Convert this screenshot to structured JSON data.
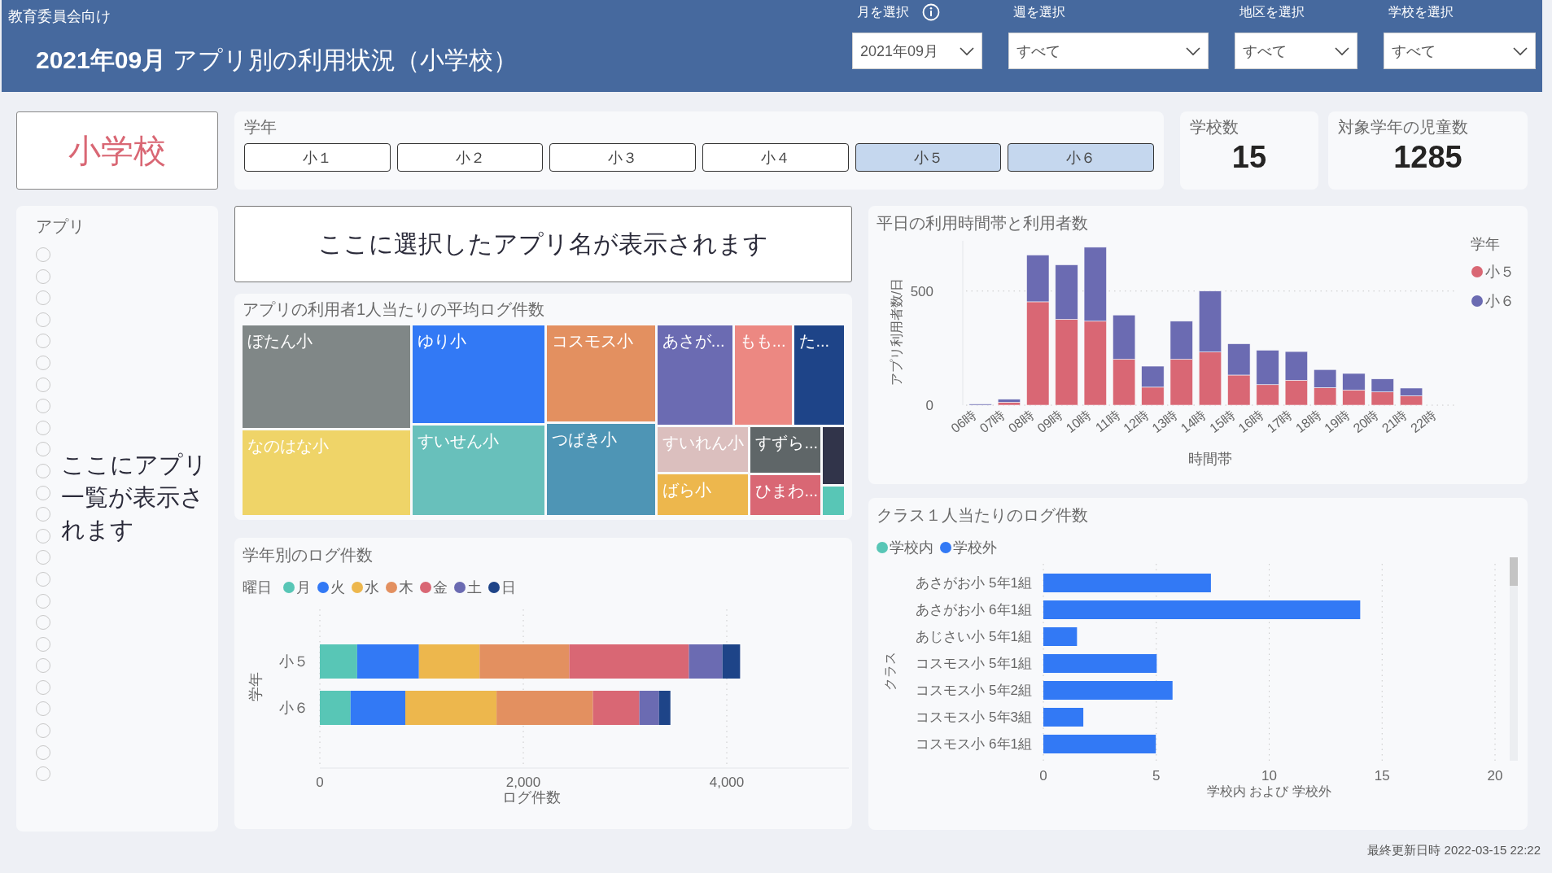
{
  "header": {
    "subtitle": "教育委員会向け",
    "title": "**2021年09月** アプリ別の利用状況（小学校）",
    "filters": [
      {
        "label": "月を選択",
        "value": "2021年09月",
        "info": true
      },
      {
        "label": "週を選択",
        "value": "すべて",
        "info": false
      },
      {
        "label": "地区を選択",
        "value": "すべて",
        "info": false
      },
      {
        "label": "学校を選択",
        "value": "すべて",
        "info": false
      }
    ]
  },
  "school_type": "小学校",
  "grade_slicer": {
    "title": "学年",
    "items": [
      {
        "label": "小１",
        "selected": false
      },
      {
        "label": "小２",
        "selected": false
      },
      {
        "label": "小３",
        "selected": false
      },
      {
        "label": "小４",
        "selected": false
      },
      {
        "label": "小５",
        "selected": true
      },
      {
        "label": "小６",
        "selected": true
      }
    ]
  },
  "kpis": [
    {
      "label": "学校数",
      "value": "15"
    },
    {
      "label": "対象学年の児童数",
      "value": "1285"
    }
  ],
  "app_list": {
    "title": "アプリ",
    "overlay_text": "ここにアプリ一覧が表示されます",
    "options": [
      {
        "selected": false
      },
      {
        "selected": false
      },
      {
        "selected": false
      },
      {
        "selected": false
      },
      {
        "selected": false
      },
      {
        "selected": false
      },
      {
        "selected": false
      },
      {
        "selected": false
      },
      {
        "selected": false
      },
      {
        "selected": false
      },
      {
        "selected": false
      },
      {
        "selected": false
      },
      {
        "selected": false
      },
      {
        "selected": false
      },
      {
        "selected": false
      },
      {
        "selected": false
      },
      {
        "selected": false
      },
      {
        "selected": false
      },
      {
        "selected": false
      },
      {
        "selected": false
      },
      {
        "selected": false
      },
      {
        "selected": false
      },
      {
        "selected": false
      },
      {
        "selected": false
      },
      {
        "selected": false
      }
    ]
  },
  "app_name_box": {
    "text": "ここに選択したアプリ名が表示されます"
  },
  "treemap": {
    "title": "アプリの利用者1人当たりの平均ログ件数",
    "blocks": [
      {
        "tiles": [
          {
            "label": "ぼたん小",
            "color": "#808787"
          },
          {
            "label": "なのはな小",
            "color": "#efd468"
          }
        ]
      },
      {
        "tiles": [
          {
            "label": "ゆり小",
            "color": "#3279f5"
          },
          {
            "label": "すいせん小",
            "color": "#68c0bb"
          }
        ]
      },
      {
        "tiles": [
          {
            "label": "コスモス小",
            "color": "#e39060"
          },
          {
            "label": "つばき小",
            "color": "#4e95b5"
          }
        ]
      },
      {
        "top": [
          {
            "label": "あさが...",
            "color": "#6b6bb2"
          },
          {
            "label": "もも...",
            "color": "#ec8882"
          },
          {
            "label": "た...",
            "color": "#1e4488"
          }
        ],
        "bottom": [
          {
            "tiles": [
              {
                "label": "すいれん小",
                "color": "#dbbfbe"
              },
              {
                "label": "ばら小",
                "color": "#edb74d"
              }
            ]
          },
          {
            "tiles": [
              {
                "label": "すずら...",
                "color": "#5f6668"
              },
              {
                "label": "ひまわ...",
                "color": "#d96774"
              }
            ]
          },
          {
            "tiles": [
              {
                "color": "#31344a"
              },
              {
                "color": "#58c6b6"
              }
            ]
          }
        ]
      }
    ]
  },
  "weekday_chart": {
    "chart_data": {
      "type": "bar",
      "orientation": "horizontal",
      "stacked": true,
      "title": "学年別のログ件数",
      "legend_title": "曜日",
      "xlabel": "ログ件数",
      "ylabel": "学年",
      "categories": [
        "小５",
        "小６"
      ],
      "series": [
        {
          "name": "月",
          "color": "#58c6b6",
          "values": [
            367,
            302
          ]
        },
        {
          "name": "火",
          "color": "#3279f5",
          "values": [
            607,
            538
          ]
        },
        {
          "name": "水",
          "color": "#edb74d",
          "values": [
            596,
            897
          ]
        },
        {
          "name": "木",
          "color": "#e39060",
          "values": [
            882,
            948
          ]
        },
        {
          "name": "金",
          "color": "#d96774",
          "values": [
            1176,
            456
          ]
        },
        {
          "name": "土",
          "color": "#6b6bb2",
          "values": [
            329,
            193
          ]
        },
        {
          "name": "日",
          "color": "#1e4488",
          "values": [
            174,
            112
          ]
        }
      ],
      "xlim": [
        0,
        5200
      ],
      "legend": "top",
      "grid": true,
      "xticks": [
        {
          "value": 0,
          "label": "0"
        },
        {
          "value": 2000,
          "label": "2,000"
        },
        {
          "value": 4000,
          "label": "4,000"
        }
      ]
    }
  },
  "hourly_chart": {
    "chart_data": {
      "type": "bar",
      "stacked": true,
      "title": "平日の利用時間帯と利用者数",
      "legend_title": "学年",
      "xlabel": "時間帯",
      "ylabel": "アプリ利用者数/日",
      "categories": [
        "06時",
        "07時",
        "08時",
        "09時",
        "10時",
        "11時",
        "12時",
        "13時",
        "14時",
        "15時",
        "16時",
        "17時",
        "18時",
        "19時",
        "20時",
        "21時",
        "22時"
      ],
      "series": [
        {
          "name": "小５",
          "color": "#d96774",
          "values": [
            null,
            13,
            453,
            376,
            368,
            201,
            79,
            201,
            233,
            132,
            90,
            109,
            77,
            66,
            58,
            41,
            null
          ]
        },
        {
          "name": "小６",
          "color": "#6b6bb2",
          "values": [
            5,
            13,
            205,
            239,
            324,
            194,
            92,
            167,
            267,
            137,
            151,
            126,
            79,
            73,
            57,
            34,
            null
          ]
        }
      ],
      "ylim": [
        0,
        720
      ],
      "legend": "right",
      "grid": true,
      "yticks": [
        0,
        500
      ]
    }
  },
  "class_chart": {
    "chart_data": {
      "type": "bar",
      "orientation": "horizontal",
      "stacked": true,
      "title": "クラス１人当たりのログ件数",
      "xlabel": "学校内 および 学校外",
      "ylabel": "クラス",
      "categories": [
        "あさがお小 5年1組",
        "あさがお小 6年1組",
        "あじさい小 5年1組",
        "コスモス小 5年1組",
        "コスモス小 5年2組",
        "コスモス小 5年3組",
        "コスモス小 6年1組"
      ],
      "series": [
        {
          "name": "学校内",
          "color": "#58c6b6",
          "values": [
            null,
            null,
            null,
            null,
            null,
            null,
            null
          ]
        },
        {
          "name": "学校外",
          "color": "#3279f5",
          "values": [
            7.42,
            14.03,
            1.49,
            5.02,
            5.72,
            1.77,
            4.98
          ]
        }
      ],
      "xlim": [
        0,
        20
      ],
      "legend": "top",
      "grid": true,
      "xticks": [
        0,
        5,
        10,
        15,
        20
      ]
    }
  },
  "footer": {
    "last_updated": "最終更新日時 2022-03-15 22:22"
  }
}
